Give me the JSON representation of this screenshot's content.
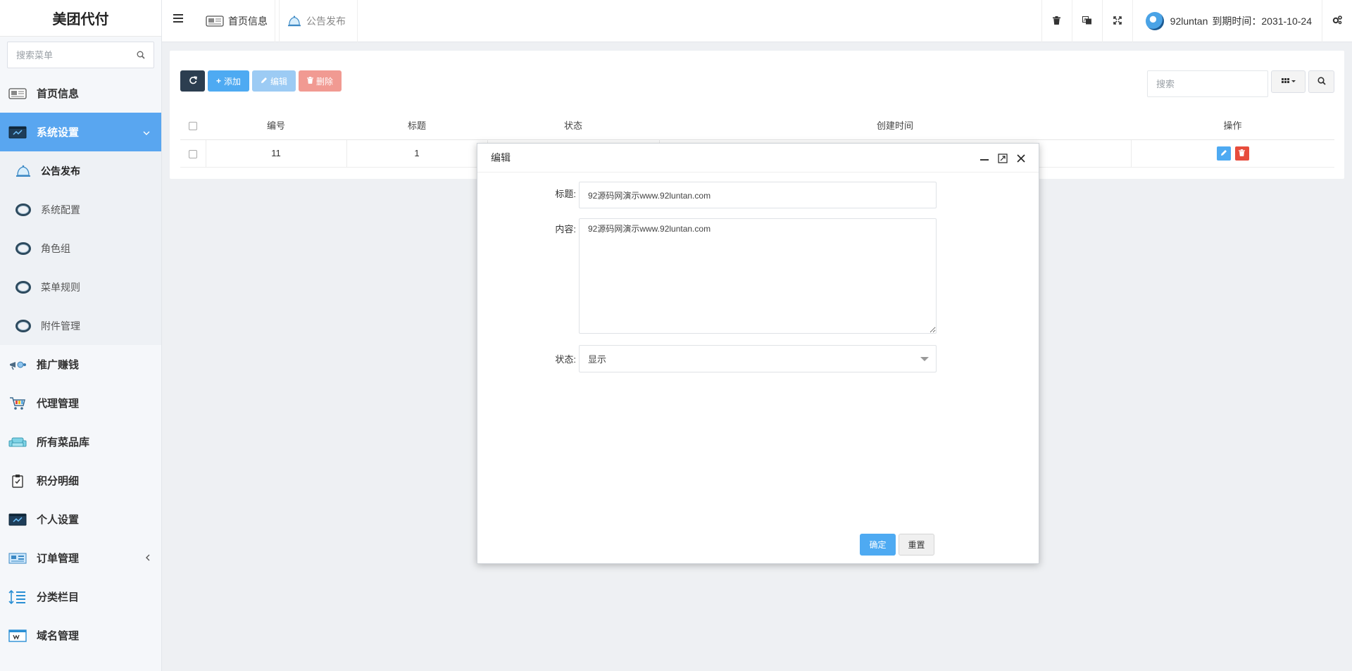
{
  "app": {
    "title": "美团代付"
  },
  "sidebar": {
    "search_placeholder": "搜索菜单",
    "items": [
      {
        "label": "首页信息",
        "icon": "dashboard-icon"
      },
      {
        "label": "系统设置",
        "icon": "settings-window-icon",
        "active": true,
        "expanded": true
      },
      {
        "label": "推广赚钱",
        "icon": "promotion-icon"
      },
      {
        "label": "代理管理",
        "icon": "cart-icon"
      },
      {
        "label": "所有菜品库",
        "icon": "sofa-icon"
      },
      {
        "label": "积分明细",
        "icon": "clipboard-icon"
      },
      {
        "label": "个人设置",
        "icon": "settings-window-icon"
      },
      {
        "label": "订单管理",
        "icon": "order-icon",
        "has_children": true
      },
      {
        "label": "分类栏目",
        "icon": "list-sort-icon"
      },
      {
        "label": "域名管理",
        "icon": "domain-icon"
      }
    ],
    "submenu": [
      {
        "label": "公告发布",
        "icon": "bell-icon",
        "current": true
      },
      {
        "label": "系统配置",
        "icon": "ring-icon"
      },
      {
        "label": "角色组",
        "icon": "ring-icon"
      },
      {
        "label": "菜单规则",
        "icon": "ring-icon"
      },
      {
        "label": "附件管理",
        "icon": "ring-icon"
      }
    ]
  },
  "topbar": {
    "tabs": [
      {
        "label": "首页信息",
        "icon": "dashboard-icon"
      },
      {
        "label": "公告发布",
        "icon": "bell-icon"
      }
    ],
    "username": "92luntan",
    "expiry_label": "到期时间：",
    "expiry_date": "2031-10-24"
  },
  "toolbar": {
    "add_label": "添加",
    "edit_label": "编辑",
    "delete_label": "删除",
    "search_placeholder": "搜索"
  },
  "table": {
    "columns": [
      "编号",
      "标题",
      "状态",
      "创建时间",
      "操作"
    ],
    "rows": [
      {
        "id": "11",
        "title": "1"
      }
    ]
  },
  "modal": {
    "title": "编辑",
    "fields": {
      "title_label": "标题:",
      "title_value": "92源码网演示www.92luntan.com",
      "content_label": "内容:",
      "content_value": "92源码网演示www.92luntan.com",
      "status_label": "状态:",
      "status_value": "显示"
    },
    "confirm_label": "确定",
    "reset_label": "重置"
  },
  "colors": {
    "accent": "#59a6f0",
    "primary_button": "#4eaaf2",
    "danger": "#e74c3c",
    "dark_button": "#2c3e50"
  }
}
